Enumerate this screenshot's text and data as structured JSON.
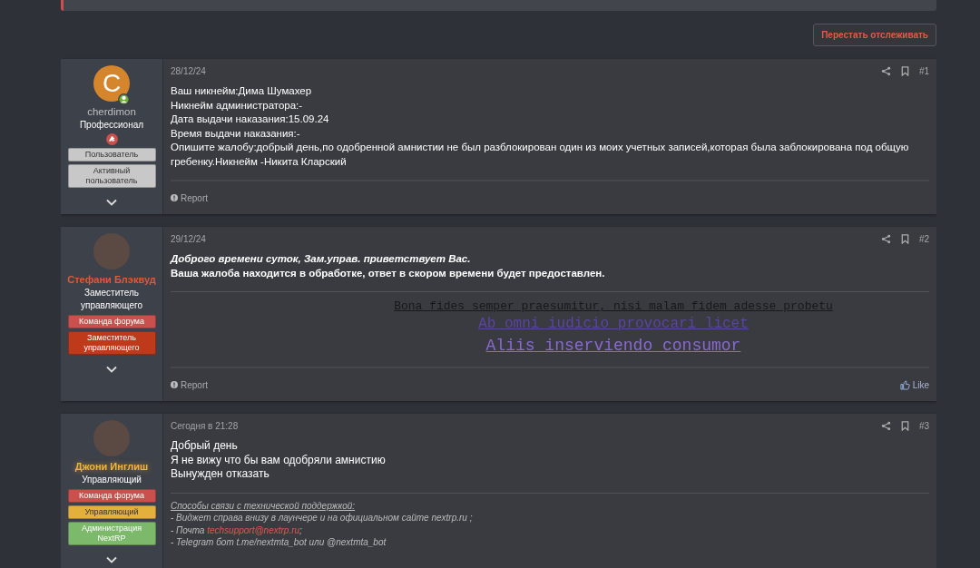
{
  "thread_actions": {
    "unwatch_button": "Перестать отслеживать"
  },
  "posts": [
    {
      "avatar": {
        "kind": "letter",
        "letter": "C",
        "color": "#d5862c"
      },
      "online": true,
      "user": {
        "name": "cherdimon",
        "color": "#bfbfbf"
      },
      "user_title": "Профессионал",
      "award_icon": true,
      "badges": [
        {
          "label": "Пользователь",
          "color": "#c8c8c8"
        },
        {
          "label": "Активный пользователь",
          "color": "#c8c8c8"
        }
      ],
      "date": "28/12/24",
      "number": "#1",
      "body": [
        {
          "kind": "plain",
          "text": "Ваш никнейм:Дима Шумахер"
        },
        {
          "kind": "plain",
          "text": "Никнейм администратора:-"
        },
        {
          "kind": "plain",
          "text": "Дата выдачи наказания:15.09.24"
        },
        {
          "kind": "plain",
          "text": "Время выдачи наказания:-"
        },
        {
          "kind": "plain",
          "text": "Опишите жалобу:добрый день,по одобренной амнистии не был разблокирован один из моих учетных записей,которая была заблокирована под общую гребенку.Никнейм -Никита Кларский"
        }
      ],
      "report": "Report"
    },
    {
      "avatar": {
        "kind": "photo"
      },
      "user": {
        "name": "Стефани Блэквуд",
        "color": "#e2583a"
      },
      "user_title": "Заместитель управляющего",
      "badges": [
        {
          "label": "Команда форума",
          "color": "#c9504c"
        },
        {
          "label": "Заместитель управляющего",
          "color": "#bf3a1b"
        }
      ],
      "date": "29/12/24",
      "number": "#2",
      "body": [
        {
          "kind": "bold-italic",
          "text": "Доброго времени суток, Зам.управ. приветствует Вас."
        },
        {
          "kind": "bold",
          "text": "Ваша жалоба находится в обработке, ответ в скором времени будет предоставлен."
        }
      ],
      "signature": [
        {
          "kind": "motto",
          "text": "Bona fides semper praesumitur, nisi malam fidem adesse probetu",
          "color": "#18181b"
        },
        {
          "kind": "motto",
          "text": "Ab omni iudicio provocari licet",
          "color": "#5a45a0"
        },
        {
          "kind": "motto-large",
          "text": "Aliis inserviendo consumor",
          "color": "#8a6ad0"
        }
      ],
      "report": "Report",
      "like": "Like"
    },
    {
      "avatar": {
        "kind": "photo"
      },
      "user": {
        "name": "Джони Инглиш",
        "color": "#f0b43a"
      },
      "user_title": "Управляющий",
      "badges": [
        {
          "label": "Команда форума",
          "color": "#c9504c"
        },
        {
          "label": "Управляющий",
          "color": "#e3b03c"
        },
        {
          "label": "Администрация NextRP",
          "color": "#7cb96a"
        }
      ],
      "date": "Сегодня в 21:28",
      "number": "#3",
      "body": [
        {
          "kind": "plain-large",
          "text": "Добрый день"
        },
        {
          "kind": "plain-large",
          "text": "Я не вижу что бы вам одобряли амнистию"
        },
        {
          "kind": "plain-large",
          "text": "Вынужден отказать"
        }
      ],
      "signature": [
        {
          "kind": "heading",
          "text": "Способы связи с технической поддержкой:"
        },
        {
          "kind": "note",
          "text": "- Виджет справа внизу в лаунчере и на официальном сайте nextrp.ru ;"
        },
        {
          "kind": "note-link",
          "text": "- Почта ",
          "link": "techsupport@nextrp.ru",
          "after": ";"
        },
        {
          "kind": "note",
          "text": "- Telegram бот t.me/nextmta_bot или @nextmta_bot"
        }
      ]
    }
  ]
}
